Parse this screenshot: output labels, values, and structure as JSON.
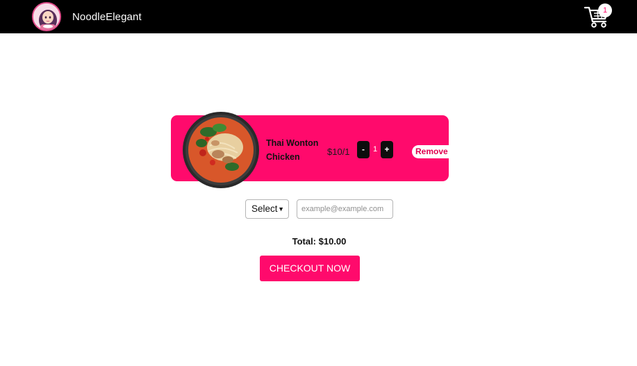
{
  "header": {
    "brand": "NoodleElegant",
    "cart_count": "1",
    "cart_icon": "shopping-cart-icon",
    "logo": "avatar-logo"
  },
  "cart": {
    "items": [
      {
        "name_line1": "Thai Wonton",
        "name_line2": "Chicken",
        "price": "$10/1",
        "quantity": "1",
        "minus_label": "-",
        "plus_label": "+",
        "remove_label": "Remove",
        "image": "noodle-bowl-image"
      }
    ]
  },
  "form": {
    "select_value": "Select",
    "email_placeholder": "example@example.com"
  },
  "summary": {
    "total": "Total: $10.00",
    "checkout_label": "CHECKOUT NOW"
  },
  "colors": {
    "accent": "#ff0a6c",
    "header_bg": "#000000",
    "qty_button": "#0d0d0d"
  }
}
